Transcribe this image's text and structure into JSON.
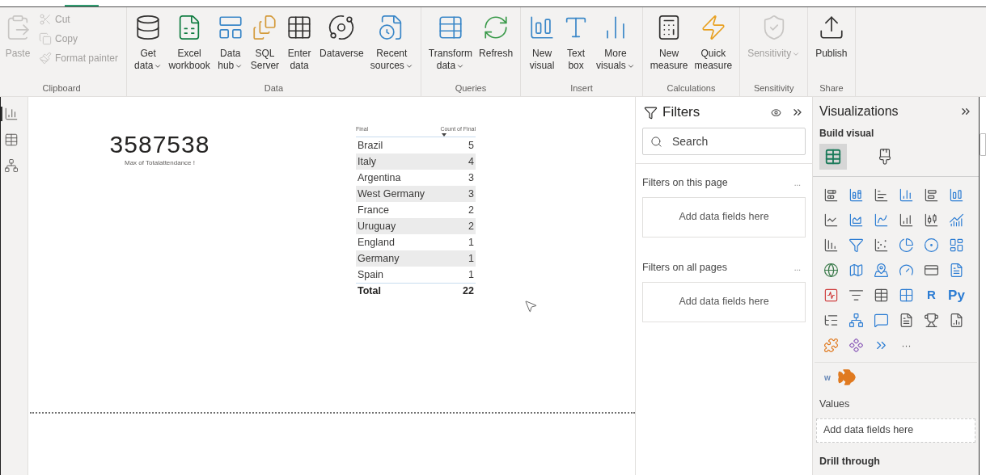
{
  "ribbon": {
    "groups": [
      {
        "label": "Clipboard",
        "buttons": [
          {
            "kind": "large",
            "lines": [
              "Paste"
            ],
            "disabled": true
          },
          {
            "kind": "small",
            "lines": [
              "Cut"
            ],
            "disabled": true
          },
          {
            "kind": "small",
            "lines": [
              "Copy"
            ],
            "disabled": true
          },
          {
            "kind": "small",
            "lines": [
              "Format painter"
            ],
            "disabled": true
          }
        ]
      },
      {
        "label": "Data",
        "buttons": [
          {
            "kind": "large",
            "lines": [
              "Get",
              "data"
            ],
            "disabled": false,
            "dropdown": true
          },
          {
            "kind": "large",
            "lines": [
              "Excel",
              "workbook"
            ],
            "disabled": false
          },
          {
            "kind": "large",
            "lines": [
              "Data",
              "hub"
            ],
            "disabled": false,
            "dropdown": true
          },
          {
            "kind": "large",
            "lines": [
              "SQL",
              "Server"
            ],
            "disabled": false
          },
          {
            "kind": "large",
            "lines": [
              "Enter",
              "data"
            ],
            "disabled": false
          },
          {
            "kind": "large",
            "lines": [
              "Dataverse"
            ],
            "disabled": false
          },
          {
            "kind": "large",
            "lines": [
              "Recent",
              "sources"
            ],
            "disabled": false,
            "dropdown": true
          }
        ]
      },
      {
        "label": "Queries",
        "buttons": [
          {
            "kind": "large",
            "lines": [
              "Transform",
              "data"
            ],
            "disabled": false,
            "dropdown": true
          },
          {
            "kind": "large",
            "lines": [
              "Refresh"
            ],
            "disabled": false
          }
        ]
      },
      {
        "label": "Insert",
        "buttons": [
          {
            "kind": "large",
            "lines": [
              "New",
              "visual"
            ],
            "disabled": false
          },
          {
            "kind": "large",
            "lines": [
              "Text",
              "box"
            ],
            "disabled": false
          },
          {
            "kind": "large",
            "lines": [
              "More",
              "visuals"
            ],
            "disabled": false,
            "dropdown": true
          }
        ]
      },
      {
        "label": "Calculations",
        "buttons": [
          {
            "kind": "large",
            "lines": [
              "New",
              "measure"
            ],
            "disabled": false
          },
          {
            "kind": "large",
            "lines": [
              "Quick",
              "measure"
            ],
            "disabled": false
          }
        ]
      },
      {
        "label": "Sensitivity",
        "buttons": [
          {
            "kind": "large",
            "lines": [
              "Sensitivity"
            ],
            "disabled": true,
            "dropdown": true
          }
        ]
      },
      {
        "label": "Share",
        "buttons": [
          {
            "kind": "large",
            "lines": [
              "Publish"
            ],
            "disabled": false
          }
        ]
      }
    ]
  },
  "nav": [
    {
      "selected": true
    },
    {
      "selected": false
    },
    {
      "selected": false
    }
  ],
  "card": {
    "value": "3587538",
    "label": "Max of Totalattendance !"
  },
  "table": {
    "columns": [
      {
        "label": "Final",
        "sorted": false
      },
      {
        "label": "Count of Final",
        "sorted": true
      }
    ],
    "rows": [
      {
        "name": "Brazil",
        "count": "5"
      },
      {
        "name": "Italy",
        "count": "4"
      },
      {
        "name": "Argentina",
        "count": "3"
      },
      {
        "name": "West Germany",
        "count": "3"
      },
      {
        "name": "France",
        "count": "2"
      },
      {
        "name": "Uruguay",
        "count": "2"
      },
      {
        "name": "England",
        "count": "1"
      },
      {
        "name": "Germany",
        "count": "1"
      },
      {
        "name": "Spain",
        "count": "1"
      }
    ],
    "total": {
      "label": "Total",
      "value": "22"
    }
  },
  "filters": {
    "title": "Filters",
    "search": {
      "placeholder": "Search"
    },
    "sections": [
      {
        "title": "Filters on this page",
        "more": "...",
        "drop": "Add data fields here"
      },
      {
        "title": "Filters on all pages",
        "more": "...",
        "drop": "Add data fields here"
      }
    ]
  },
  "visualizations": {
    "title": "Visualizations",
    "subtitle": "Build visual",
    "modes": [
      {
        "selected": true
      },
      {
        "selected": false
      }
    ],
    "glyphs": [
      "R",
      "Py",
      "···"
    ],
    "custom": [
      "w"
    ],
    "wells": [
      {
        "title": "Values",
        "drop": "Add data fields here"
      }
    ],
    "next_section": "Drill through"
  }
}
